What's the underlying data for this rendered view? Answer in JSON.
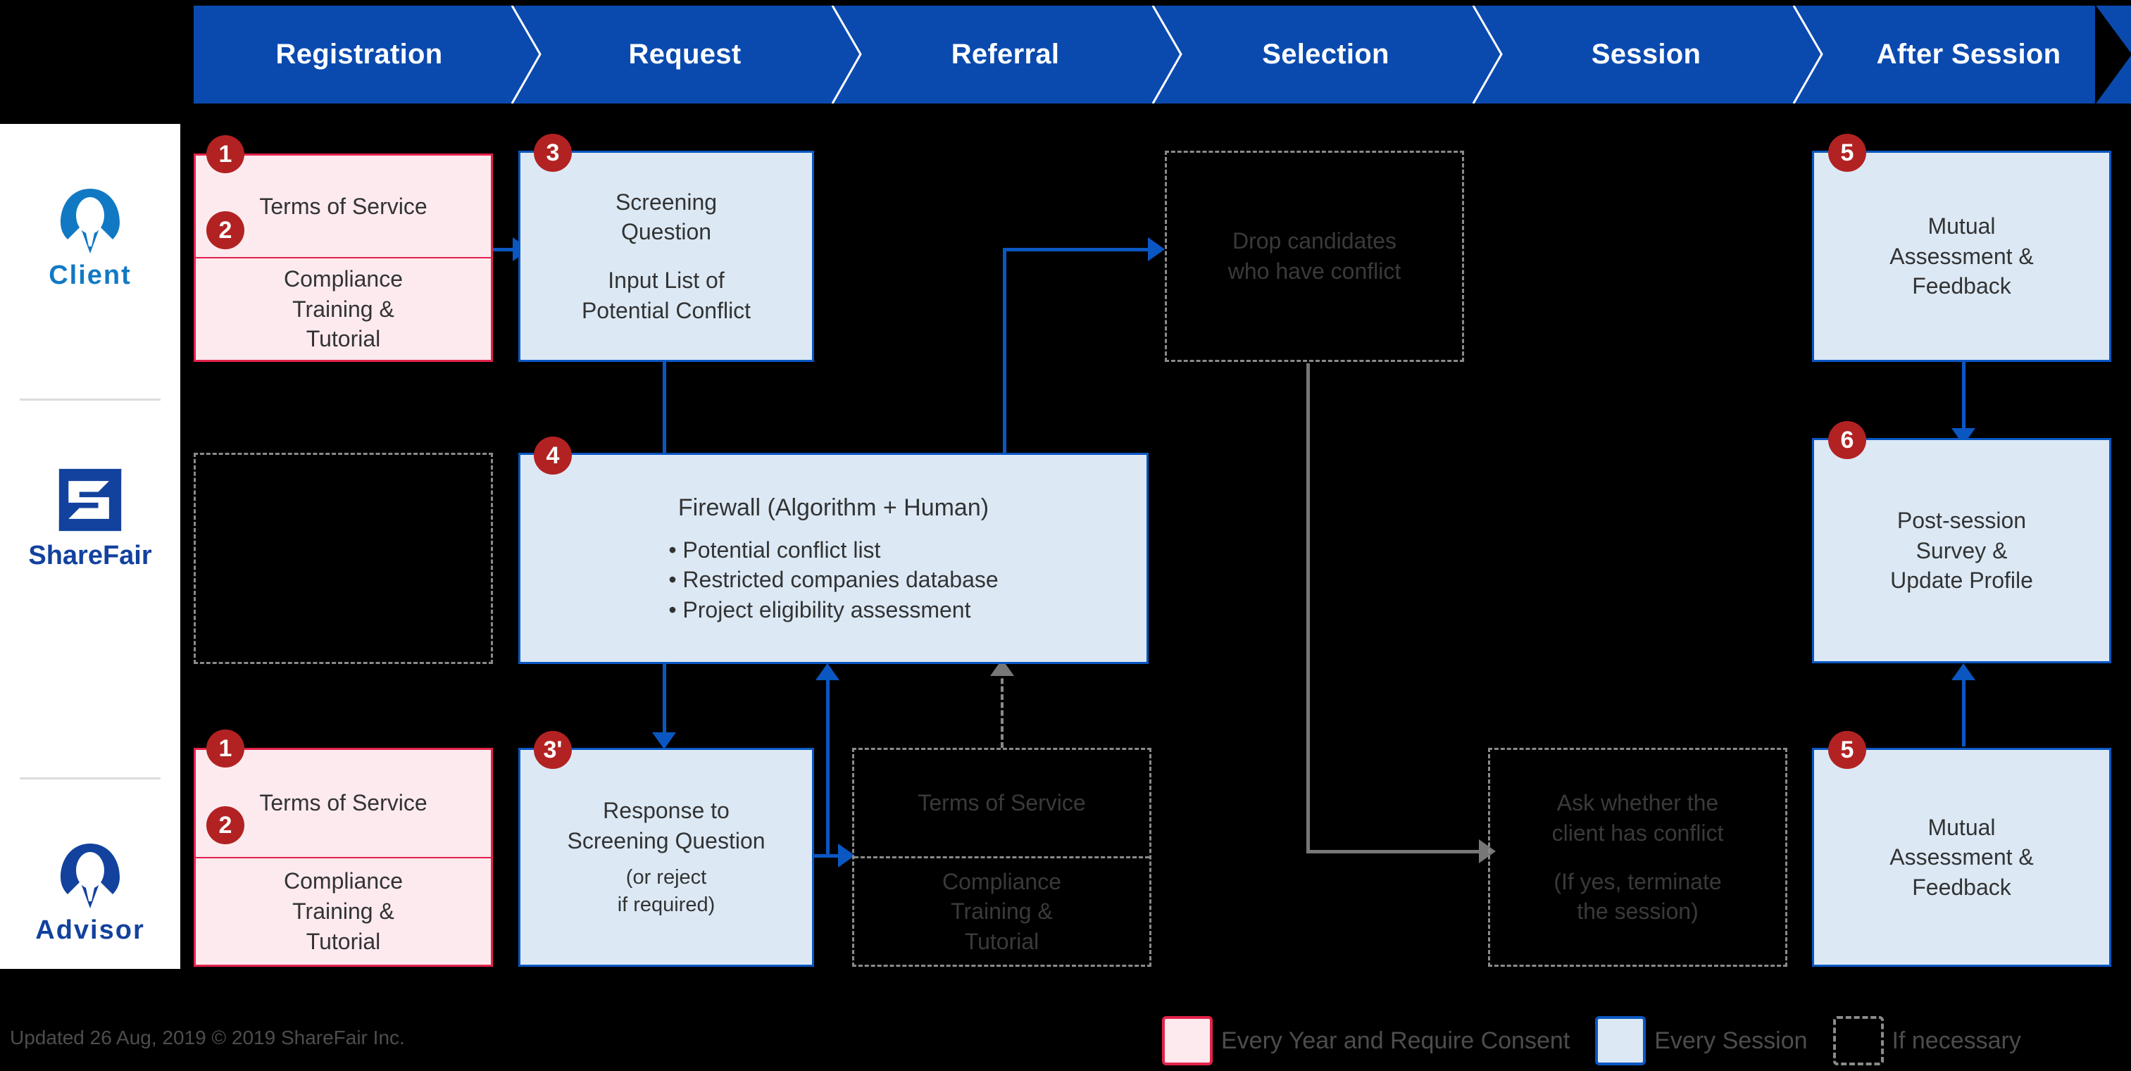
{
  "header": {
    "stages": [
      {
        "label": "Registration"
      },
      {
        "label": "Request"
      },
      {
        "label": "Referral"
      },
      {
        "label": "Selection"
      },
      {
        "label": "Session"
      },
      {
        "label": "After Session"
      }
    ]
  },
  "rail": {
    "actors": [
      {
        "label": "Client",
        "icon": "person-client-icon",
        "color": "#1179C4"
      },
      {
        "label": "ShareFair",
        "icon": "sharefair-logo-icon",
        "color": "#12429E"
      },
      {
        "label": "Advisor",
        "icon": "person-advisor-icon",
        "color": "#12429E"
      }
    ]
  },
  "nodes": {
    "client_registration": {
      "badge_top": "1",
      "badge_bottom": "2",
      "top_text": "Terms of Service",
      "bottom_line1": "Compliance",
      "bottom_line2": "Training &",
      "bottom_line3": "Tutorial"
    },
    "client_request": {
      "badge": "3",
      "line1": "Screening",
      "line2": "Question",
      "line3": "Input List of",
      "line4": "Potential Conflict"
    },
    "sharefair_registration_empty": {
      "text": ""
    },
    "firewall": {
      "badge": "4",
      "title": "Firewall (Algorithm + Human)",
      "bullets": [
        "• Potential conflict list",
        "• Restricted companies database",
        "• Project eligibility assessment"
      ]
    },
    "advisor_registration": {
      "badge_top": "1",
      "badge_bottom": "2",
      "top_text": "Terms of Service",
      "bottom_line1": "Compliance",
      "bottom_line2": "Training &",
      "bottom_line3": "Tutorial"
    },
    "advisor_request": {
      "badge": "3'",
      "line1": "Response to",
      "line2": "Screening Question",
      "line3": "(or reject",
      "line4": "if required)"
    },
    "referral_dashed": {
      "top_text": "Terms of Service",
      "bottom_line1": "Compliance",
      "bottom_line2": "Training &",
      "bottom_line3": "Tutorial"
    },
    "drop_candidates": {
      "line1": "Drop candidates",
      "line2": "who have conflict"
    },
    "ask_conflict": {
      "line1": "Ask whether the",
      "line2": "client has conflict",
      "line3": "(If yes, terminate",
      "line4": "the session)"
    },
    "client_after_session": {
      "badge": "5",
      "line1": "Mutual",
      "line2": "Assessment &",
      "line3": "Feedback"
    },
    "post_session": {
      "badge": "6",
      "line1": "Post-session",
      "line2": "Survey &",
      "line3": "Update Profile"
    },
    "advisor_after_session": {
      "badge": "5",
      "line1": "Mutual",
      "line2": "Assessment &",
      "line3": "Feedback"
    }
  },
  "legend": {
    "items": [
      {
        "swatch": "pink",
        "label": "Every Year and Require Consent"
      },
      {
        "swatch": "blue",
        "label": "Every Session"
      },
      {
        "swatch": "dash",
        "label": "If necessary"
      }
    ]
  },
  "footer": {
    "text": "Updated 26 Aug, 2019  © 2019 ShareFair Inc."
  },
  "colors": {
    "ribbon_blue": "#0A4AAF",
    "box_blue_fill": "#DCE9F5",
    "box_blue_border": "#0A57C2",
    "box_pink_fill": "#FCEAEF",
    "box_pink_border": "#E3234B",
    "badge_red": "#B22222",
    "dashed_gray": "#8A8A8A",
    "background": "#000000"
  }
}
